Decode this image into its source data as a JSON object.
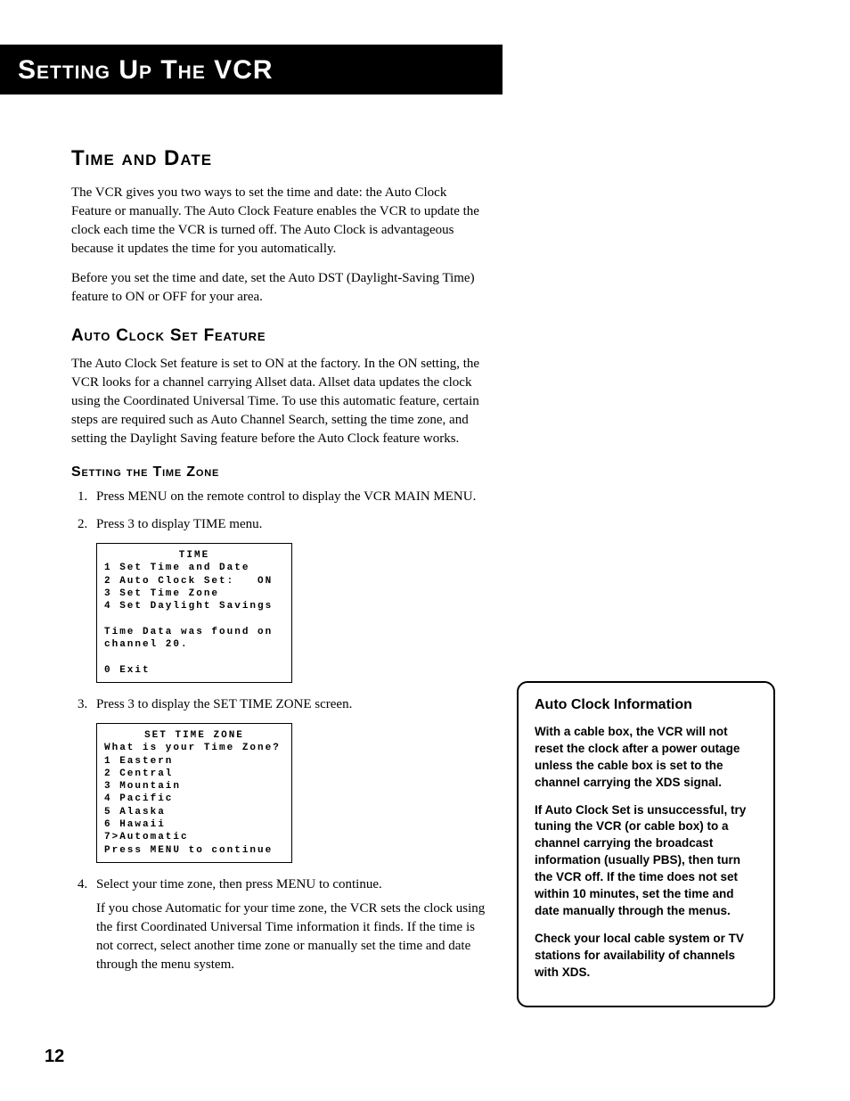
{
  "header": {
    "title": "Setting Up the VCR"
  },
  "section": {
    "heading": "Time and Date",
    "intro1": "The VCR gives you two ways to set the time and date: the Auto Clock Feature or manually. The Auto Clock Feature enables the VCR to update the clock each time the VCR is turned off. The Auto Clock is advantageous because it updates the time for you automatically.",
    "intro2": "Before you set the time and date, set the Auto DST (Daylight-Saving Time) feature to ON or OFF for your area."
  },
  "autoClock": {
    "heading": "Auto Clock Set Feature",
    "body": "The Auto Clock Set feature is set to ON at the factory. In the ON setting, the VCR looks for a channel carrying Allset data. Allset data updates the clock using the Coordinated Universal Time. To use this automatic feature, certain steps are required such as Auto Channel Search, setting the time zone, and setting the Daylight Saving feature before the Auto Clock feature works."
  },
  "timeZone": {
    "heading": "Setting the Time Zone",
    "steps": {
      "s1": "Press MENU on the remote control to display the VCR MAIN MENU.",
      "s2": "Press 3 to display TIME menu.",
      "s3": "Press 3 to display the SET TIME ZONE screen.",
      "s4": "Select your time zone, then press MENU to continue.",
      "s4b": "If you chose Automatic for your time zone, the VCR sets the clock using the first Coordinated Universal Time information it finds. If the time is not correct, select another time zone or manually set the time and date through the menu system."
    }
  },
  "screens": {
    "time": {
      "title": "TIME",
      "l1": "1 Set Time and Date",
      "l2": "2 Auto Clock Set:   ON",
      "l3": "3 Set Time Zone",
      "l4": "4 Set Daylight Savings",
      "l5": "Time Data was found on",
      "l6": "channel 20.",
      "l7": "0 Exit"
    },
    "zone": {
      "title": "SET TIME ZONE",
      "q": "What is your Time Zone?",
      "o1": "1 Eastern",
      "o2": "2 Central",
      "o3": "3 Mountain",
      "o4": "4 Pacific",
      "o5": "5 Alaska",
      "o6": "6 Hawaii",
      "o7": "7>Automatic",
      "foot": "Press MENU to continue"
    }
  },
  "sidebar": {
    "heading": "Auto Clock Information",
    "p1": "With a cable box, the VCR will not reset the clock after a power outage unless the cable box is set to the channel carrying the XDS signal.",
    "p2": "If Auto Clock Set is unsuccessful, try tuning the VCR (or cable box) to a channel carrying the broadcast information (usually PBS), then turn the VCR off. If the time does not set within 10 minutes, set the time and date manually through the menus.",
    "p3": "Check your local cable system or TV stations for availability of channels with XDS."
  },
  "pageNumber": "12"
}
